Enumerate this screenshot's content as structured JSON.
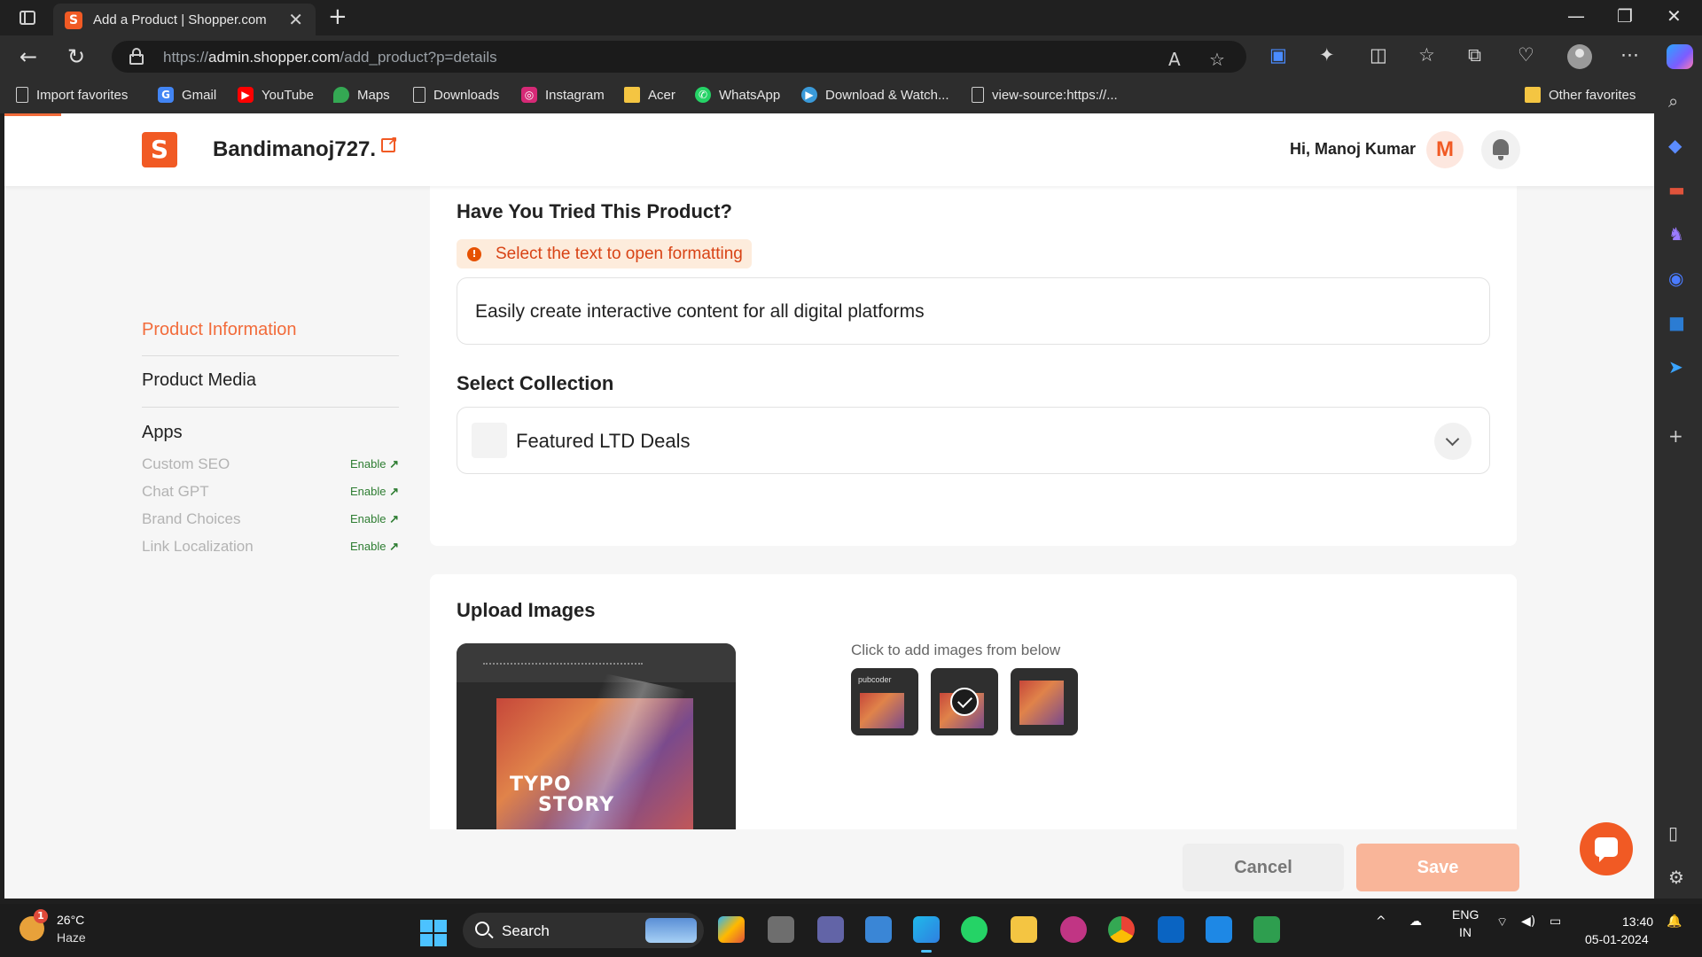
{
  "browser": {
    "tab_title": "Add a Product | Shopper.com",
    "url_prefix": "https://",
    "url_host": "admin.shopper.com",
    "url_path": "/add_product?p=details",
    "favorites": [
      {
        "label": "Import favorites",
        "icon": "import-icon"
      },
      {
        "label": "Gmail",
        "icon": "google-icon",
        "color": "#4285f4"
      },
      {
        "label": "YouTube",
        "icon": "youtube-icon",
        "color": "#ff0000"
      },
      {
        "label": "Maps",
        "icon": "maps-icon",
        "color": "#34a853"
      },
      {
        "label": "Downloads",
        "icon": "page-icon"
      },
      {
        "label": "Instagram",
        "icon": "instagram-icon",
        "color": "#d62976"
      },
      {
        "label": "Acer",
        "icon": "folder-icon"
      },
      {
        "label": "WhatsApp",
        "icon": "whatsapp-icon",
        "color": "#25d366"
      },
      {
        "label": "Download & Watch...",
        "icon": "play-icon",
        "color": "#3a9ad9"
      },
      {
        "label": "view-source:https://...",
        "icon": "page-icon"
      }
    ],
    "other_favorites": "Other favorites"
  },
  "header": {
    "store_name": "Bandimanoj727.",
    "greeting": "Hi, Manoj Kumar",
    "avatar_initial": "M",
    "brand_color": "#f15a24"
  },
  "sidebar": {
    "items": [
      {
        "label": "Product Information",
        "active": true
      },
      {
        "label": "Product Media",
        "active": false
      }
    ],
    "apps_heading": "Apps",
    "apps": [
      {
        "name": "Custom SEO",
        "action": "Enable"
      },
      {
        "name": "Chat GPT",
        "action": "Enable"
      },
      {
        "name": "Brand Choices",
        "action": "Enable"
      },
      {
        "name": "Link Localization",
        "action": "Enable"
      }
    ]
  },
  "form": {
    "tried_title": "Have You Tried This Product?",
    "format_hint": "Select the text to open formatting",
    "tried_value": "Easily create interactive content for all digital platforms",
    "collection_title": "Select Collection",
    "collection_value": "Featured LTD Deals"
  },
  "upload": {
    "title": "Upload Images",
    "hint": "Click to add images from below",
    "preview_text_1": "TYPO",
    "preview_text_2": "STORY",
    "thumb_label": "pubcoder"
  },
  "actions": {
    "cancel": "Cancel",
    "save": "Save"
  },
  "taskbar": {
    "temperature": "26°C",
    "weather": "Haze",
    "weather_badge": "1",
    "search": "Search",
    "lang_top": "ENG",
    "lang_bottom": "IN",
    "time": "13:40",
    "date": "05-01-2024"
  }
}
